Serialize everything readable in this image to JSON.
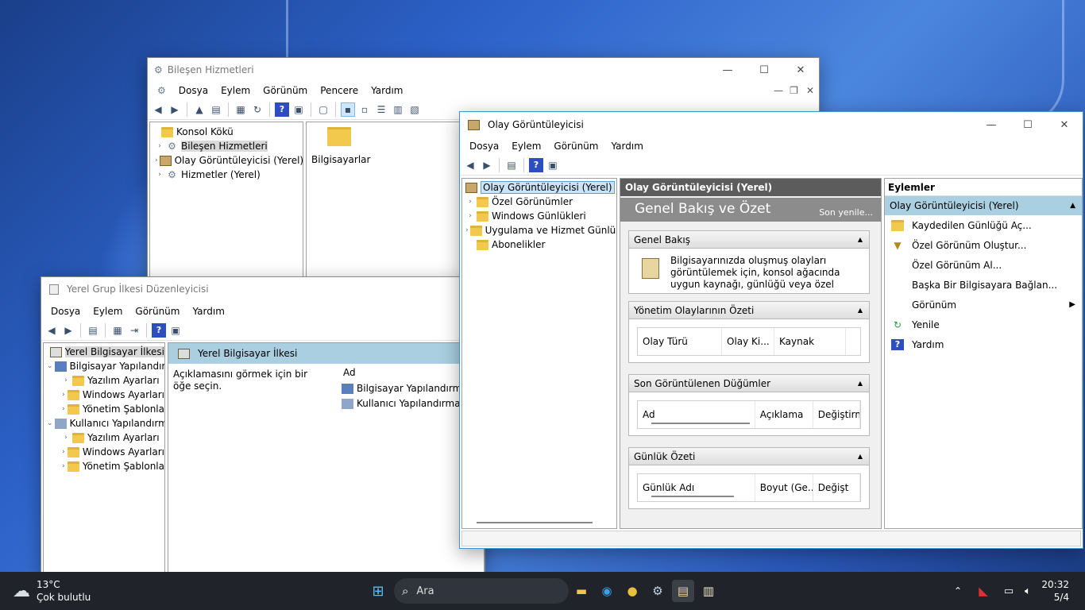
{
  "component_window": {
    "title": "Bileşen Hizmetleri",
    "menu": [
      "Dosya",
      "Eylem",
      "Görünüm",
      "Pencere",
      "Yardım"
    ],
    "tree": [
      "Konsol Kökü",
      "Bileşen Hizmetleri",
      "Olay Görüntüleyicisi (Yerel)",
      "Hizmetler (Yerel)"
    ],
    "content_item": "Bilgisayarlar"
  },
  "gpedit_window": {
    "title": "Yerel Grup İlkesi Düzenleyicisi",
    "menu": [
      "Dosya",
      "Eylem",
      "Görünüm",
      "Yardım"
    ],
    "tree": [
      "Yerel Bilgisayar İlkesi",
      "Bilgisayar Yapılandırm",
      "Yazılım Ayarları",
      "Windows Ayarları",
      "Yönetim Şablonla",
      "Kullanıcı Yapılandırm",
      "Yazılım Ayarları",
      "Windows Ayarları",
      "Yönetim Şablonla"
    ],
    "content_header": "Yerel Bilgisayar İlkesi",
    "description": "Açıklamasını görmek için bir öğe seçin.",
    "column": "Ad",
    "items": [
      "Bilgisayar Yapılandırması",
      "Kullanıcı Yapılandırması"
    ]
  },
  "event_window": {
    "title": "Olay Görüntüleyicisi",
    "menu": [
      "Dosya",
      "Eylem",
      "Görünüm",
      "Yardım"
    ],
    "tree": [
      "Olay Görüntüleyicisi (Yerel)",
      "Özel Görünümler",
      "Windows Günlükleri",
      "Uygulama ve Hizmet Günlük",
      "Abonelikler"
    ],
    "center_header": "Olay Görüntüleyicisi (Yerel)",
    "banner_title": "Genel Bakış ve Özet",
    "banner_refresh": "Son yenile...",
    "overview_title": "Genel Bakış",
    "overview_text": "Bilgisayarınızda oluşmuş olayları görüntülemek için, konsol ağacında uygun kaynağı, günlüğü veya özel",
    "admin_title": "Yönetim Olaylarının Özeti",
    "admin_cols": [
      "Olay Türü",
      "Olay Ki...",
      "Kaynak"
    ],
    "recent_title": "Son Görüntülenen Düğümler",
    "recent_cols": [
      "Ad",
      "Açıklama",
      "Değiştirm"
    ],
    "log_title": "Günlük Özeti",
    "log_cols": [
      "Günlük Adı",
      "Boyut (Ge...",
      "Değişt"
    ],
    "actions_header": "Eylemler",
    "actions_selected": "Olay Görüntüleyicisi (Yerel)",
    "actions": [
      "Kaydedilen Günlüğü Aç...",
      "Özel Görünüm Oluştur...",
      "Özel Görünüm Al...",
      "Başka Bir Bilgisayara Bağlan...",
      "Görünüm",
      "Yenile",
      "Yardım"
    ]
  },
  "taskbar": {
    "weather_temp": "13°C",
    "weather_desc": "Çok bulutlu",
    "search_label": "Ara",
    "time": "20:32",
    "date": "5/4"
  }
}
